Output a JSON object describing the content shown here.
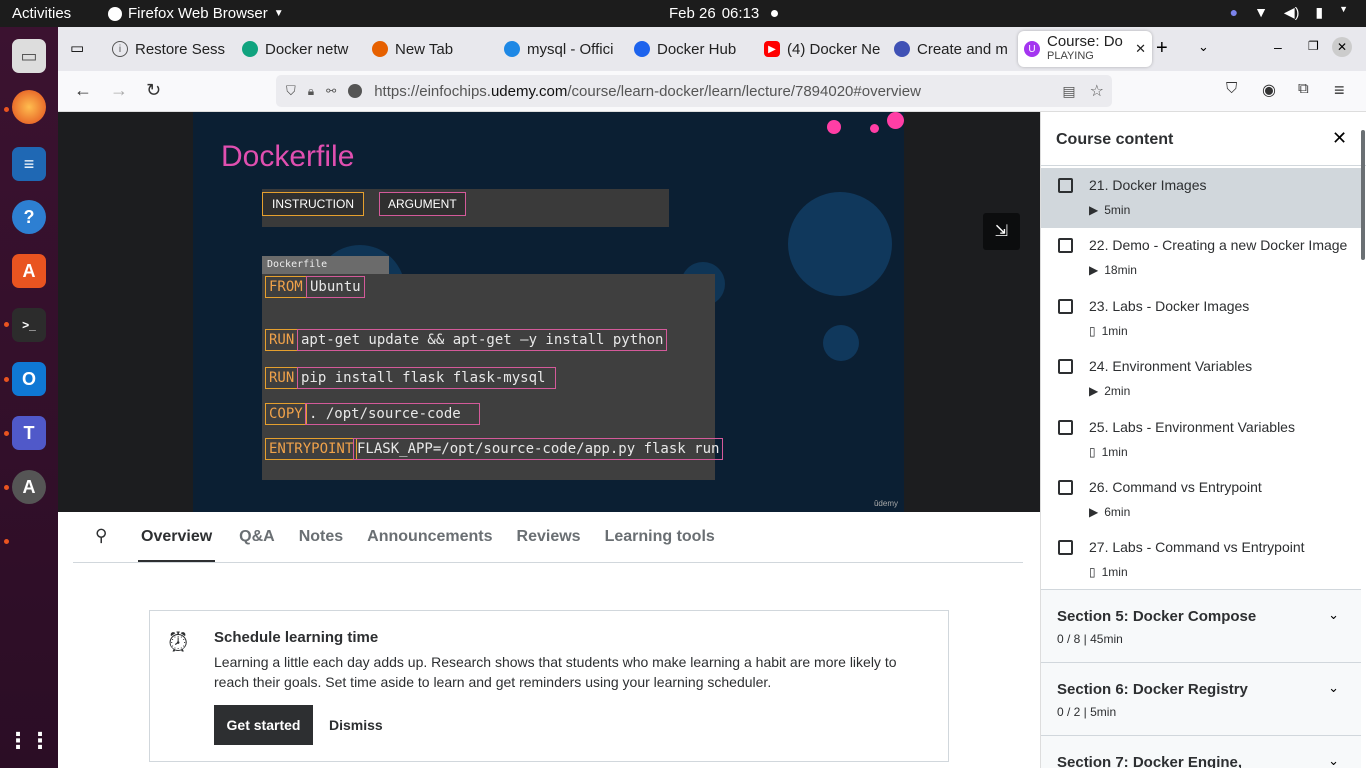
{
  "system": {
    "activities": "Activities",
    "app": "Firefox Web Browser",
    "date": "Feb 26",
    "time": "06:13"
  },
  "tabs": [
    {
      "label": "Restore Sess",
      "color": "#666"
    },
    {
      "label": "Docker netw",
      "color": "#10a37f"
    },
    {
      "label": "New Tab",
      "color": "#e66000"
    },
    {
      "label": "mysql - Offici",
      "color": "#1e88e5"
    },
    {
      "label": "Docker Hub",
      "color": "#1d63ed"
    },
    {
      "label": "(4) Docker Ne",
      "color": "#ff0000"
    },
    {
      "label": "Create and m",
      "color": "#3f51b5"
    },
    {
      "label": "Course: Do",
      "sub": "PLAYING",
      "color": "#a435f0"
    }
  ],
  "url": {
    "prefix": "https://einfochips.",
    "domain": "udemy.com",
    "path": "/course/learn-docker/learn/lecture/7894020#overview"
  },
  "slide": {
    "title": "Dockerfile",
    "instruction": "INSTRUCTION",
    "argument": "ARGUMENT",
    "file_label": "Dockerfile",
    "watermark": "ûdemy",
    "lines": [
      {
        "kw": "FROM",
        "arg": "Ubuntu"
      },
      {
        "kw": "RUN",
        "arg": "apt-get update && apt-get –y install python"
      },
      {
        "kw": "RUN",
        "arg": "pip install flask flask-mysql"
      },
      {
        "kw": "COPY",
        "arg": ". /opt/source-code"
      },
      {
        "kw": "ENTRYPOINT",
        "arg": "FLASK_APP=/opt/source-code/app.py flask run"
      }
    ]
  },
  "nav_tabs": [
    "Overview",
    "Q&A",
    "Notes",
    "Announcements",
    "Reviews",
    "Learning tools"
  ],
  "schedule": {
    "title": "Schedule learning time",
    "body": "Learning a little each day adds up. Research shows that students who make learning a habit are more likely to reach their goals. Set time aside to learn and get reminders using your learning scheduler.",
    "primary": "Get started",
    "secondary": "Dismiss"
  },
  "sidebar": {
    "title": "Course content",
    "lectures": [
      {
        "title": "21. Docker Images",
        "dur": "5min",
        "kind": "video"
      },
      {
        "title": "22. Demo - Creating a new Docker Image",
        "dur": "18min",
        "kind": "video"
      },
      {
        "title": "23. Labs - Docker Images",
        "dur": "1min",
        "kind": "file"
      },
      {
        "title": "24. Environment Variables",
        "dur": "2min",
        "kind": "video"
      },
      {
        "title": "25. Labs - Environment Variables",
        "dur": "1min",
        "kind": "file"
      },
      {
        "title": "26. Command vs Entrypoint",
        "dur": "6min",
        "kind": "video"
      },
      {
        "title": "27. Labs - Command vs Entrypoint",
        "dur": "1min",
        "kind": "file"
      }
    ],
    "sections": [
      {
        "title": "Section 5: Docker Compose",
        "sub": "0 / 8 | 45min"
      },
      {
        "title": "Section 6: Docker Registry",
        "sub": "0 / 2 | 5min"
      },
      {
        "title": "Section 7: Docker Engine,",
        "sub": ""
      }
    ]
  }
}
